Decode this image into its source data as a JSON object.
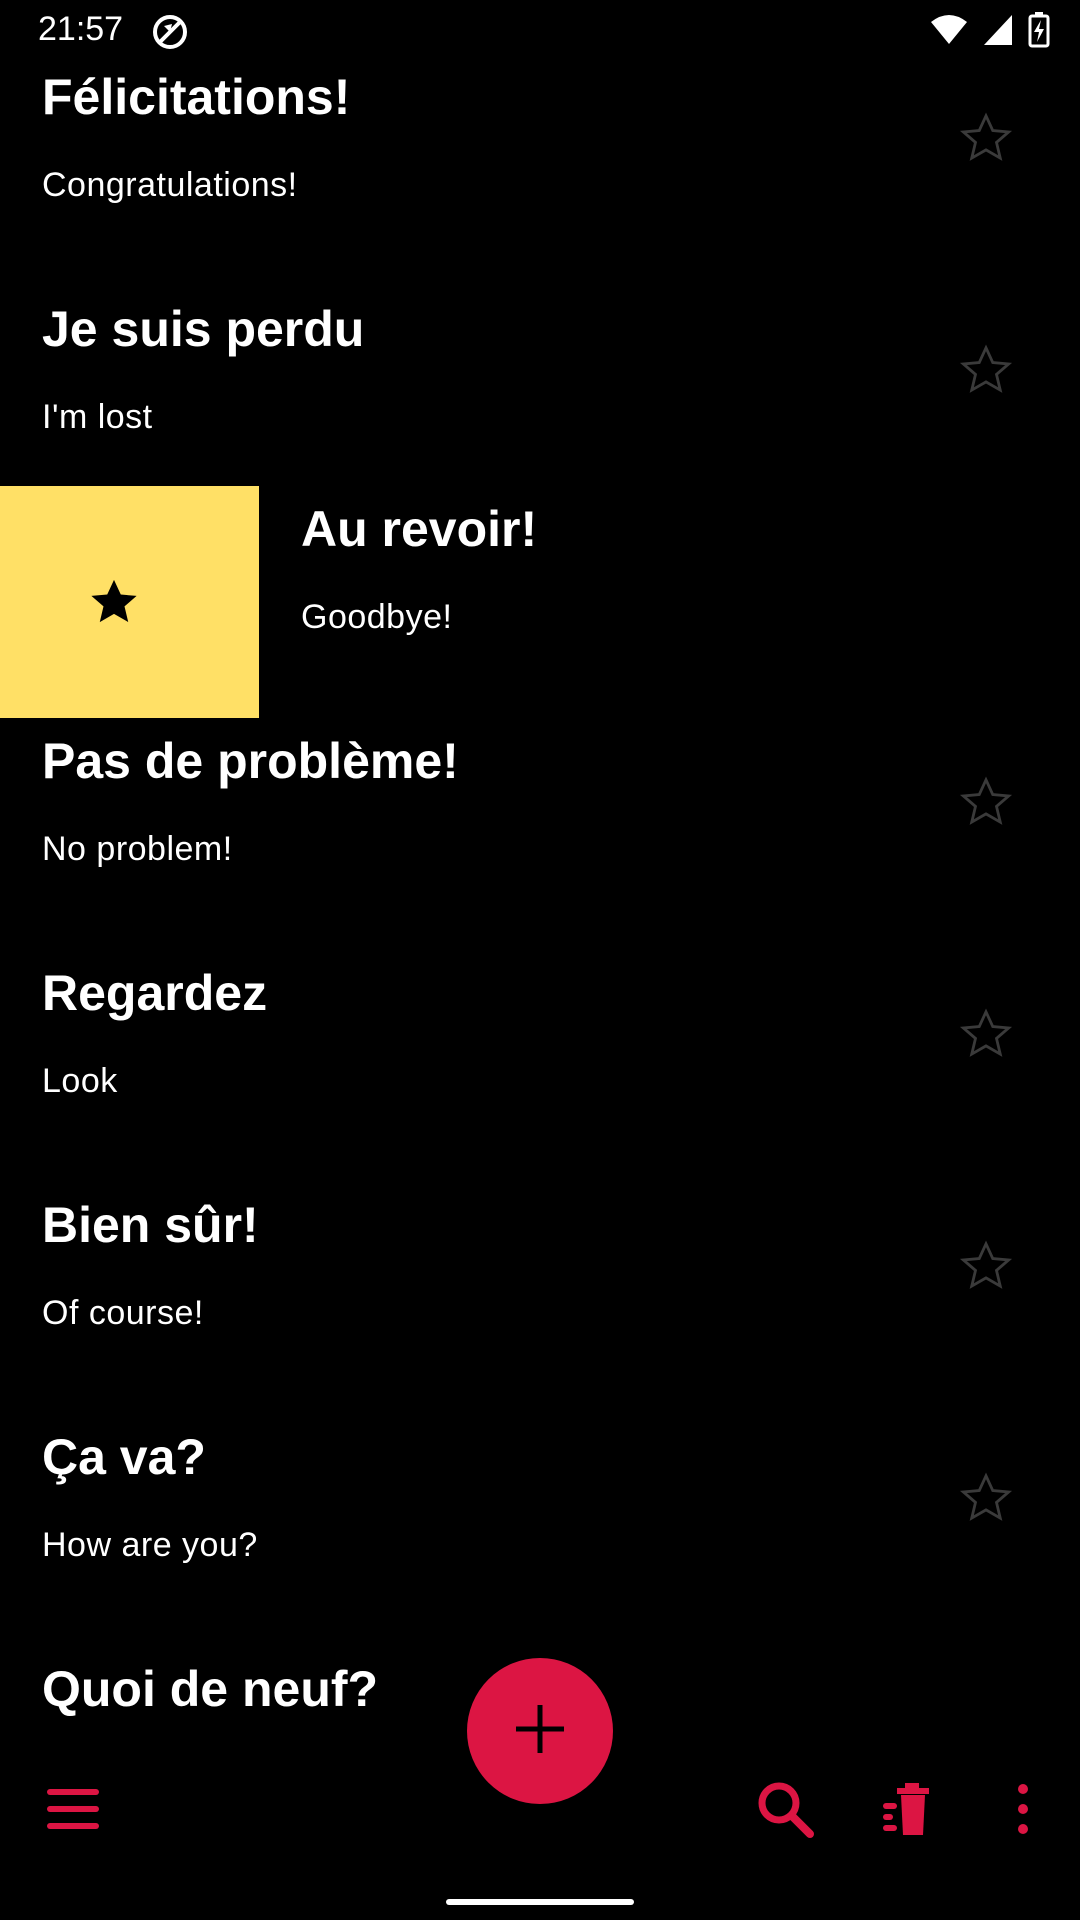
{
  "status_bar": {
    "time": "21:57",
    "icons": [
      "sync-icon",
      "wifi-icon",
      "signal-icon",
      "battery-charging-icon"
    ]
  },
  "colors": {
    "background": "#000000",
    "accent": "#DC1543",
    "swipe_background": "#FFE066",
    "star_outline": "#3A3A3A"
  },
  "phrases": [
    {
      "phrase": "Félicitations!",
      "translation": "Congratulations!",
      "starred": false
    },
    {
      "phrase": "Je suis perdu",
      "translation": "I'm lost",
      "starred": false
    },
    {
      "phrase": "Au revoir!",
      "translation": "Goodbye!",
      "starred": true,
      "swiped": true
    },
    {
      "phrase": "Pas de problème!",
      "translation": "No problem!",
      "starred": false
    },
    {
      "phrase": "Regardez",
      "translation": "Look",
      "starred": false
    },
    {
      "phrase": "Bien sûr!",
      "translation": "Of course!",
      "starred": false
    },
    {
      "phrase": "Ça va?",
      "translation": "How are you?",
      "starred": false
    },
    {
      "phrase": "Quoi de neuf?",
      "translation": "",
      "starred": false
    }
  ],
  "bottom_bar": {
    "icons": [
      "menu-icon",
      "search-icon",
      "delete-sweep-icon",
      "more-vert-icon"
    ],
    "fab_icon": "add-icon"
  }
}
